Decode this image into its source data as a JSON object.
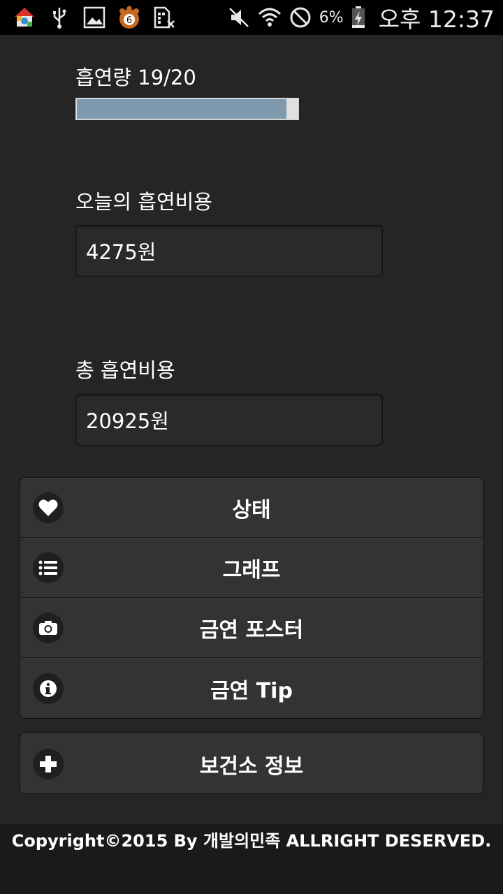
{
  "status_bar": {
    "notification_icons": [
      "home-launcher-icon",
      "usb-icon",
      "image-icon",
      "paw-badge-icon",
      "sim-off-icon"
    ],
    "badge_count": "6",
    "system_icons": [
      "mute-icon",
      "wifi-icon",
      "block-icon",
      "battery-icon"
    ],
    "battery_percent": "6%",
    "time": "오후 12:37"
  },
  "smoking": {
    "count_label": "흡연량 19/20",
    "count_progress": 0.95,
    "today_cost_label": "오늘의 흡연비용",
    "today_cost_value": "4275원",
    "total_cost_label": "총 흡연비용",
    "total_cost_value": "20925원"
  },
  "menu": {
    "items": [
      {
        "label": "상태",
        "icon": "heart-icon"
      },
      {
        "label": "그래프",
        "icon": "list-icon"
      },
      {
        "label": "금연 포스터",
        "icon": "camera-icon"
      },
      {
        "label": "금연 Tip",
        "icon": "info-icon"
      }
    ],
    "extra": {
      "label": "보건소 정보",
      "icon": "plus-icon"
    }
  },
  "footer": {
    "copyright": "Copyright©2015 By 개발의민족 ALLRIGHT DESERVED."
  },
  "colors": {
    "background": "#252525",
    "progress_fill": "#7f9aaf",
    "list_bg": "#333333",
    "status_bar": "#000000"
  }
}
